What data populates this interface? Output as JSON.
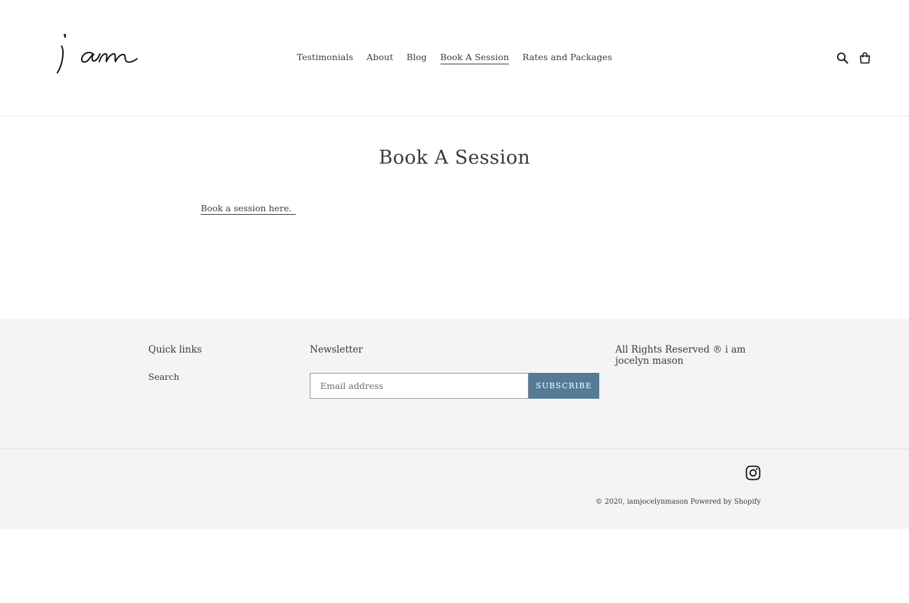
{
  "header": {
    "logo_alt": "i am",
    "nav": [
      {
        "label": "Testimonials"
      },
      {
        "label": "About"
      },
      {
        "label": "Blog"
      },
      {
        "label": "Book A Session",
        "active": true
      },
      {
        "label": "Rates and Packages"
      }
    ],
    "icons": [
      "search-icon",
      "cart-icon"
    ]
  },
  "main": {
    "title": "Book A Session",
    "link_text": "Book a session here."
  },
  "footer": {
    "quick_links_title": "Quick links",
    "quick_links": [
      {
        "label": "Search"
      }
    ],
    "newsletter_title": "Newsletter",
    "email_placeholder": "Email address",
    "subscribe_label": "SUBSCRIBE",
    "rights_text": "All Rights Reserved ® i am jocelyn mason",
    "social_icons": [
      "instagram-icon"
    ],
    "copyright_prefix": "© 2020,",
    "copyright_name": "iamjocelynmason",
    "powered_by": "Powered by Shopify"
  },
  "colors": {
    "accent": "#557b97",
    "footer_bg": "#f4f4f4",
    "text": "#3a3a3a"
  }
}
